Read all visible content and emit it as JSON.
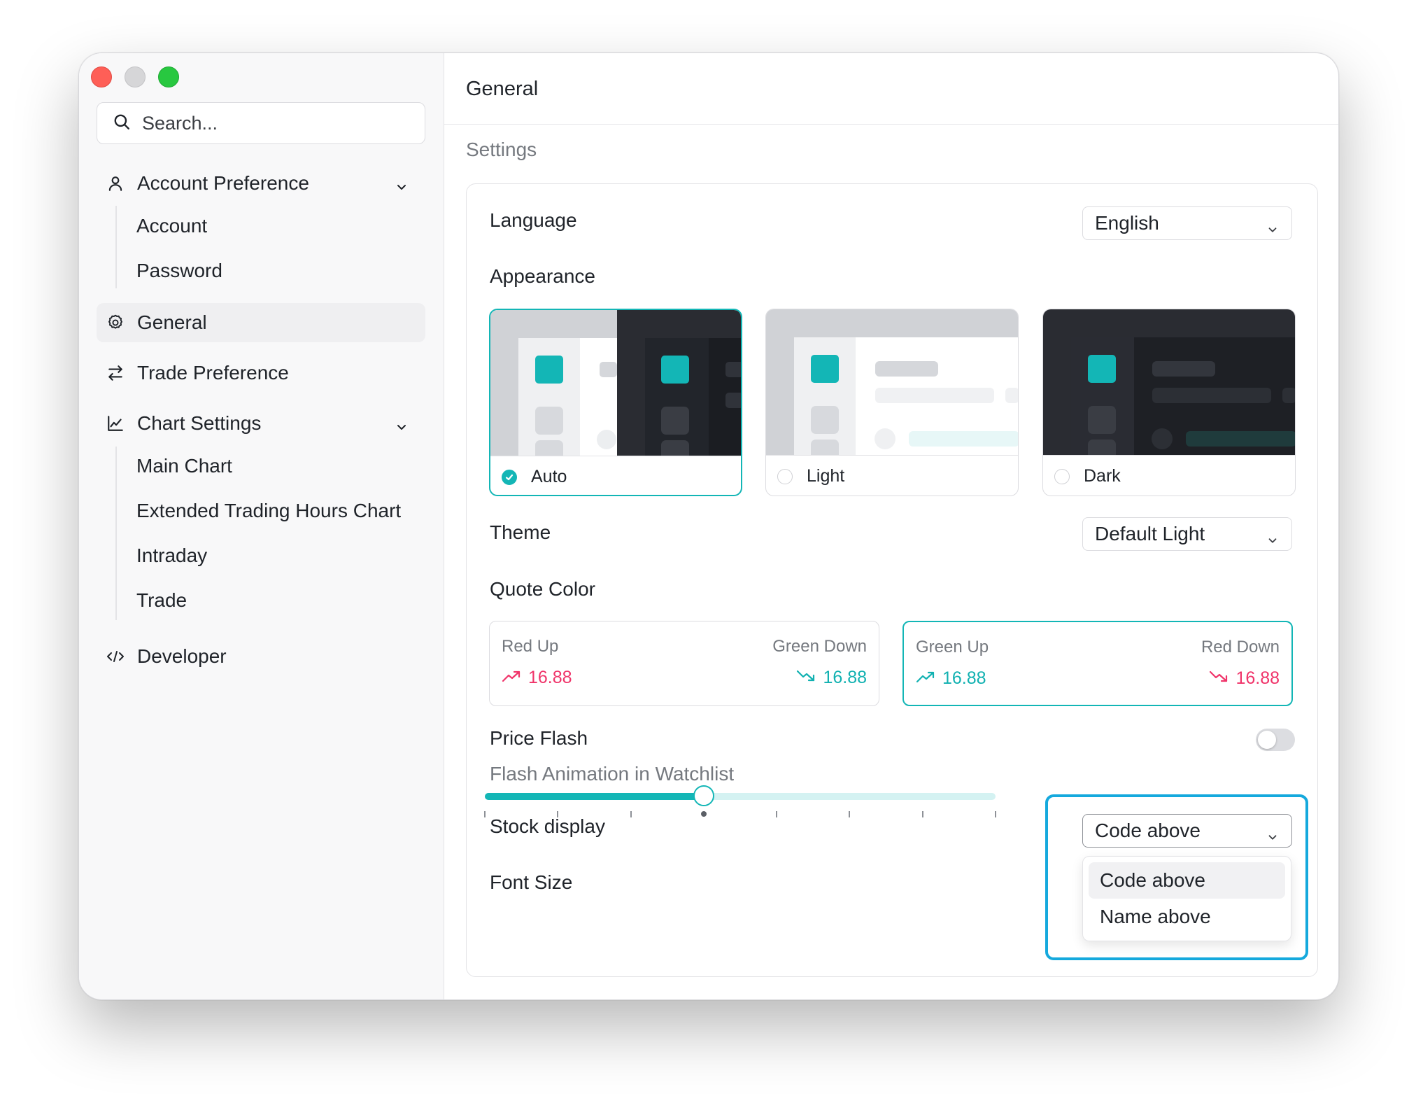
{
  "sidebar": {
    "search_placeholder": "Search...",
    "items": [
      {
        "label": "Account Preference",
        "icon": "user-icon",
        "expanded": true,
        "children": [
          "Account",
          "Password"
        ]
      },
      {
        "label": "General",
        "icon": "gear-icon",
        "active": true
      },
      {
        "label": "Trade Preference",
        "icon": "swap-arrows-icon"
      },
      {
        "label": "Chart Settings",
        "icon": "line-chart-icon",
        "expanded": true,
        "children": [
          "Main Chart",
          "Extended Trading Hours Chart",
          "Intraday",
          "Trade"
        ]
      },
      {
        "label": "Developer",
        "icon": "code-icon"
      }
    ]
  },
  "main": {
    "title": "General",
    "section": "Settings"
  },
  "settings": {
    "language": {
      "label": "Language",
      "value": "English"
    },
    "appearance": {
      "label": "Appearance",
      "options": [
        {
          "label": "Auto",
          "selected": true
        },
        {
          "label": "Light",
          "selected": false
        },
        {
          "label": "Dark",
          "selected": false
        }
      ]
    },
    "theme": {
      "label": "Theme",
      "value": "Default Light"
    },
    "quote_color": {
      "label": "Quote Color",
      "options": [
        {
          "up_label": "Red Up",
          "down_label": "Green Down",
          "up_value": "16.88",
          "down_value": "16.88",
          "selected": false
        },
        {
          "up_label": "Green Up",
          "down_label": "Red Down",
          "up_value": "16.88",
          "down_value": "16.88",
          "selected": true
        }
      ]
    },
    "price_flash": {
      "label": "Price Flash",
      "description": "Flash Animation in Watchlist",
      "enabled": false
    },
    "stock_display": {
      "label": "Stock display",
      "value": "Code above",
      "options": [
        "Code above",
        "Name above"
      ]
    },
    "font_size": {
      "label": "Font Size",
      "level": 4,
      "steps": 8
    }
  },
  "colors": {
    "accent": "#13b6b6",
    "red": "#f0346a",
    "green": "#11b1b1",
    "focus": "#15a9dd"
  }
}
